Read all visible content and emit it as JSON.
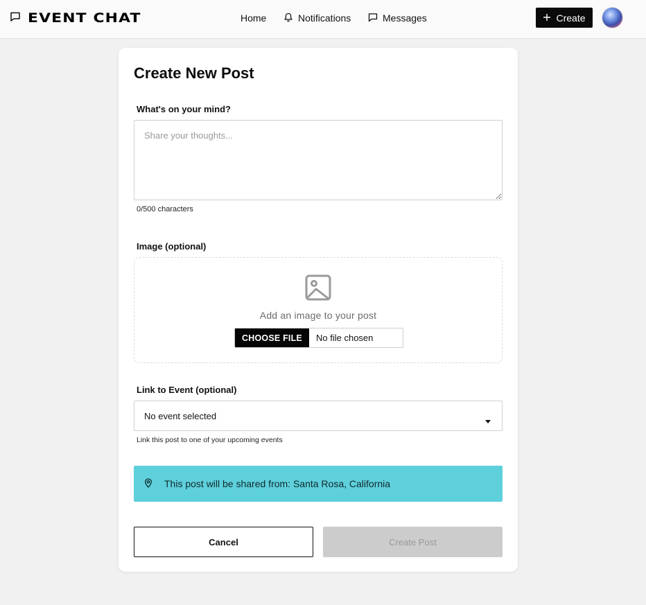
{
  "header": {
    "brand": "EVENT CHAT",
    "brand_icon": "chat-bubble-icon",
    "nav": {
      "home": "Home",
      "notifications": "Notifications",
      "messages": "Messages"
    },
    "create_label": "Create"
  },
  "form": {
    "title": "Create New Post",
    "content": {
      "label": "What's on your mind?",
      "placeholder": "Share your thoughts...",
      "value": "",
      "counter": "0/500 characters"
    },
    "image": {
      "label": "Image (optional)",
      "prompt": "Add an image to your post",
      "choose_label": "CHOOSE FILE",
      "file_status": "No file chosen"
    },
    "event": {
      "label": "Link to Event (optional)",
      "selected": "No event selected",
      "hint": "Link this post to one of your upcoming events"
    },
    "location": {
      "text": "This post will be shared from: Santa Rosa, California"
    },
    "actions": {
      "cancel": "Cancel",
      "submit": "Create Post"
    }
  },
  "colors": {
    "location_banner": "#5ed0dc",
    "primary": "#0a0a0a",
    "disabled": "#cccccc"
  }
}
